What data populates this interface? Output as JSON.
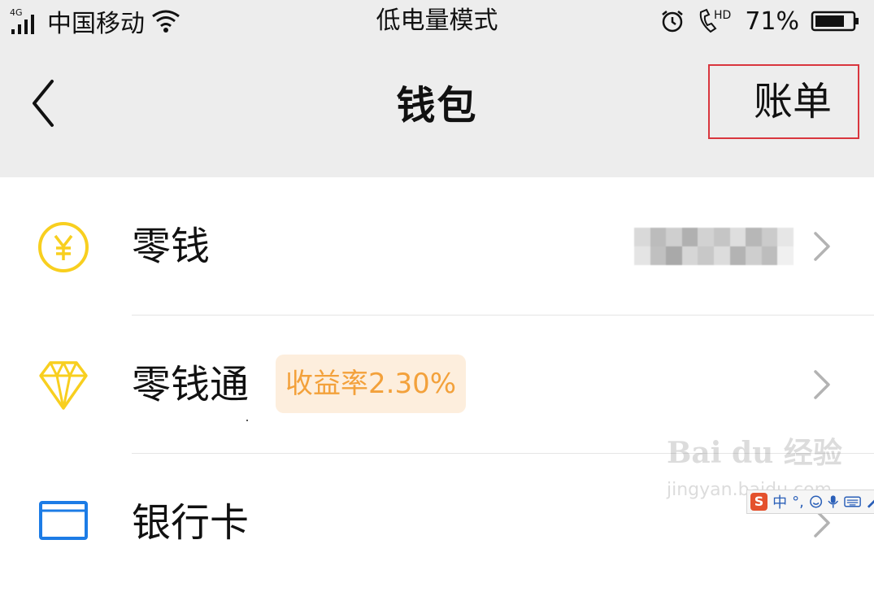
{
  "status_bar": {
    "network": "4G",
    "carrier": "中国移动",
    "mode": "低电量模式",
    "battery_percent": "71%",
    "icons": [
      "signal-icon",
      "wifi-icon",
      "alarm-icon",
      "hd-call-icon",
      "battery-icon"
    ]
  },
  "nav": {
    "title": "钱包",
    "bill_label": "账单",
    "back_icon": "chevron-left-icon"
  },
  "list": {
    "items": [
      {
        "label": "零钱",
        "icon": "yuan-coin-icon"
      },
      {
        "label": "零钱通",
        "icon": "diamond-icon",
        "badge": "收益率2.30%"
      },
      {
        "label": "银行卡",
        "icon": "bank-card-icon"
      }
    ]
  },
  "watermark": {
    "main": "Bai  du 经验",
    "sub": "jingyan.baidu.com"
  },
  "ime": {
    "logo": "S",
    "items": [
      "中",
      "°,"
    ]
  },
  "colors": {
    "bar_bg": "#ededed",
    "highlight_border": "#d9363e",
    "icon_yellow": "#f8cf1f",
    "badge_bg": "#fdeedd",
    "badge_text": "#f3a13b",
    "card_blue": "#1c7ce6"
  }
}
